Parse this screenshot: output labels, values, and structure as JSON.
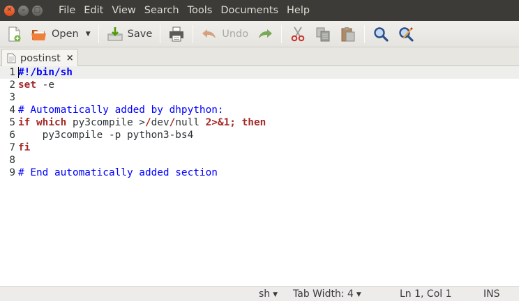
{
  "window": {
    "controls": {
      "close": "✕",
      "minimize": "–",
      "maximize": "□"
    }
  },
  "menu": [
    "File",
    "Edit",
    "View",
    "Search",
    "Tools",
    "Documents",
    "Help"
  ],
  "toolbar": {
    "open_label": "Open",
    "save_label": "Save",
    "undo_label": "Undo",
    "icons": [
      "new-document-icon",
      "open-folder-icon",
      "save-icon",
      "print-icon",
      "undo-icon",
      "redo-icon",
      "cut-icon",
      "copy-icon",
      "paste-icon",
      "search-icon",
      "replace-icon"
    ]
  },
  "tabs": [
    {
      "label": "postinst",
      "close": "×"
    }
  ],
  "editor": {
    "current_line": 1,
    "lines": [
      {
        "number": "1",
        "text": "#!/bin/sh"
      },
      {
        "number": "2",
        "text": "set -e"
      },
      {
        "number": "3",
        "text": ""
      },
      {
        "number": "4",
        "text": "# Automatically added by dhpython:"
      },
      {
        "number": "5",
        "text": "if which py3compile >/dev/null 2>&1; then"
      },
      {
        "number": "6",
        "text": "    py3compile -p python3-bs4"
      },
      {
        "number": "7",
        "text": "fi"
      },
      {
        "number": "8",
        "text": ""
      },
      {
        "number": "9",
        "text": "# End automatically added section"
      }
    ],
    "colors": {
      "keyword": "#a52a2a",
      "comment": "#0000ff",
      "plain": "#2e3436",
      "current_line": "#eeeeec"
    }
  },
  "statusbar": {
    "language": "sh",
    "tab_width": "Tab Width: 4",
    "position": "Ln 1, Col 1",
    "mode": "INS"
  }
}
